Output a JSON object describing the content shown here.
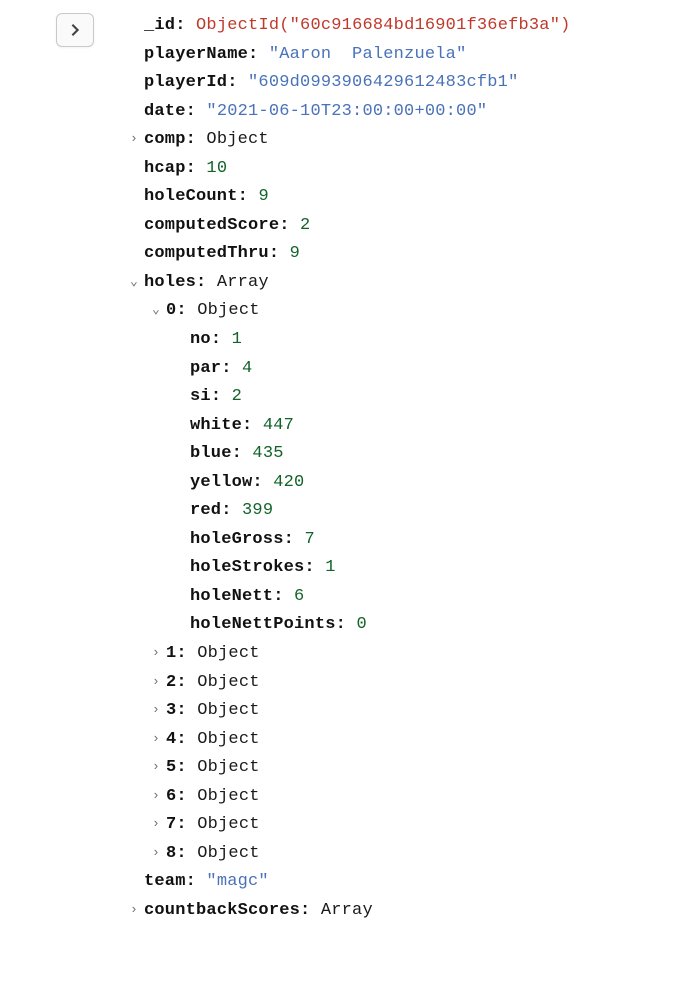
{
  "doc": {
    "id_key": "_id",
    "id_fn": "ObjectId(",
    "id_val": "\"60c916684bd16901f36efb3a\"",
    "id_fn_close": ")",
    "playerName_key": "playerName",
    "playerName_val": "\"Aaron  Palenzuela\"",
    "playerId_key": "playerId",
    "playerId_val": "\"609d0993906429612483cfb1\"",
    "date_key": "date",
    "date_val": "\"2021-06-10T23:00:00+00:00\"",
    "comp_key": "comp",
    "comp_type": "Object",
    "hcap_key": "hcap",
    "hcap_val": "10",
    "holeCount_key": "holeCount",
    "holeCount_val": "9",
    "computedScore_key": "computedScore",
    "computedScore_val": "2",
    "computedThru_key": "computedThru",
    "computedThru_val": "9",
    "holes_key": "holes",
    "holes_type": "Array",
    "hole0_key": "0",
    "hole0_type": "Object",
    "hole0": {
      "no_key": "no",
      "no_val": "1",
      "par_key": "par",
      "par_val": "4",
      "si_key": "si",
      "si_val": "2",
      "white_key": "white",
      "white_val": "447",
      "blue_key": "blue",
      "blue_val": "435",
      "yellow_key": "yellow",
      "yellow_val": "420",
      "red_key": "red",
      "red_val": "399",
      "holeGross_key": "holeGross",
      "holeGross_val": "7",
      "holeStrokes_key": "holeStrokes",
      "holeStrokes_val": "1",
      "holeNett_key": "holeNett",
      "holeNett_val": "6",
      "holeNettPoints_key": "holeNettPoints",
      "holeNettPoints_val": "0"
    },
    "hole1_key": "1",
    "hole1_type": "Object",
    "hole2_key": "2",
    "hole2_type": "Object",
    "hole3_key": "3",
    "hole3_type": "Object",
    "hole4_key": "4",
    "hole4_type": "Object",
    "hole5_key": "5",
    "hole5_type": "Object",
    "hole6_key": "6",
    "hole6_type": "Object",
    "hole7_key": "7",
    "hole7_type": "Object",
    "hole8_key": "8",
    "hole8_type": "Object",
    "team_key": "team",
    "team_val": "\"magc\"",
    "countbackScores_key": "countbackScores",
    "countbackScores_type": "Array"
  },
  "glyph": {
    "right": "›",
    "down": "⌄"
  }
}
